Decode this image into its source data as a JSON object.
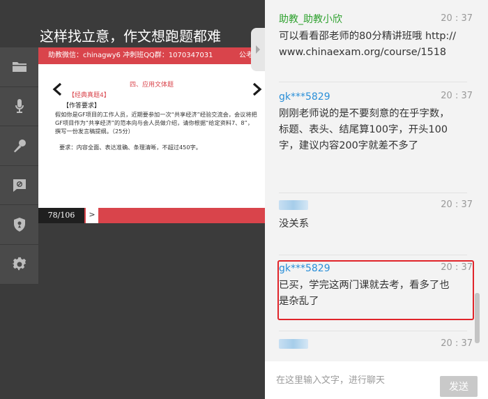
{
  "video": {
    "title": "这样找立意，作文想跑题都难"
  },
  "toolbar": {
    "items": [
      {
        "name": "folder-icon"
      },
      {
        "name": "microphone-icon"
      },
      {
        "name": "mic-stand-icon"
      },
      {
        "name": "chat-mute-icon"
      },
      {
        "name": "shield-icon"
      },
      {
        "name": "gear-icon"
      }
    ]
  },
  "slide": {
    "header": "助教微信：chinagwy6  冲刺班QQ群：1070347031",
    "header_hint": "公考",
    "section": "四、应用文体题",
    "tag": "【经典真题4】",
    "sub": "【作答要求】",
    "body": "假如你是GF项目的工作人员，近期要参加一次“共享经济”经验交流会，会议将把GF项目作为“共享经济”的范本向与会人员做介绍，请你根据“给定资料7、8”，撰写一份发言稿提纲。（25分）",
    "requirement": "要求：内容全面、表达准确、条理清晰，不超过450字。",
    "page": "78/106",
    "next": ">"
  },
  "chat": {
    "messages": [
      {
        "name": "助教_助教小欣",
        "time": "20 : 37",
        "text": "可以看看邵老师的80分精讲班哦 http://www.chinaexam.org/course/1518",
        "name_color": "#2ea12e"
      },
      {
        "name": "gk***5829",
        "time": "20 : 37",
        "text": "刚刚老师说的是不要刻意的在乎字数，标题、表头、结尾算100字，开头100字，建议内容200字就差不多了",
        "name_color": "#2a8fd8"
      },
      {
        "name": "",
        "time": "20 : 37",
        "text": "没关系",
        "name_color": "#2a8fd8"
      },
      {
        "name": "gk***5829",
        "time": "20 : 37",
        "text": "已买，学完这两门课就去考，看多了也是杂乱了",
        "name_color": "#2a8fd8"
      },
      {
        "name": "",
        "time": "20 : 37",
        "text": "",
        "name_color": "#2a8fd8"
      }
    ],
    "input_placeholder": "在这里输入文字，进行聊天",
    "send_label": "发送"
  },
  "colors": {
    "slide_accent": "#d9444b",
    "highlight": "#e0242a",
    "teacher_name": "#2ea12e",
    "user_name": "#2a8fd8"
  }
}
